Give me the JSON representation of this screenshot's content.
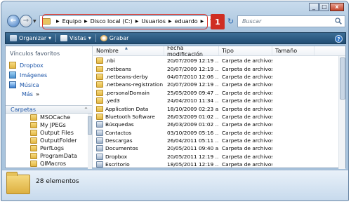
{
  "window": {
    "caption_buttons": {
      "minimize": "_",
      "maximize": "□",
      "close": "x"
    }
  },
  "address_bar": {
    "crumbs": [
      "Equipo",
      "Disco local (C:)",
      "Usuarios",
      "eduardo"
    ],
    "step_badge": "1"
  },
  "search": {
    "placeholder": "Buscar"
  },
  "toolbar": {
    "organize_label": "Organizar",
    "views_label": "Vistas",
    "burn_label": "Grabar",
    "help_label": "?"
  },
  "nav_pane": {
    "favorites_heading": "Vínculos favoritos",
    "favorites": [
      {
        "label": "Dropbox",
        "icon": "dropbox-icon"
      },
      {
        "label": "Imágenes",
        "icon": "pictures-icon"
      },
      {
        "label": "Música",
        "icon": "music-icon"
      }
    ],
    "more_label": "Más",
    "more_arrow": "»",
    "folders_label": "Carpetas",
    "folders_chevron": "^",
    "tree": [
      "MSOCache",
      "My JPEGs",
      "Output Files",
      "OutputFolder",
      "PerfLogs",
      "ProgramData",
      "QIMacros"
    ]
  },
  "file_list": {
    "columns": [
      "Nombre",
      "Fecha modificación",
      "Tipo",
      "Tamaño"
    ],
    "rows": [
      {
        "name": ".nbi",
        "date": "20/07/2009 12:19 ...",
        "type": "Carpeta de archivos",
        "size": "",
        "icon": "folder"
      },
      {
        "name": ".netbeans",
        "date": "20/07/2009 12:19 ...",
        "type": "Carpeta de archivos",
        "size": "",
        "icon": "folder"
      },
      {
        "name": ".netbeans-derby",
        "date": "04/07/2010 12:06 ...",
        "type": "Carpeta de archivos",
        "size": "",
        "icon": "folder"
      },
      {
        "name": ".netbeans-registration",
        "date": "20/07/2009 12:19 ...",
        "type": "Carpeta de archivos",
        "size": "",
        "icon": "folder"
      },
      {
        "name": ".personalDomain",
        "date": "25/05/2009 09:47 ...",
        "type": "Carpeta de archivos",
        "size": "",
        "icon": "folder"
      },
      {
        "name": ".yed3",
        "date": "24/04/2010 11:34 ...",
        "type": "Carpeta de archivos",
        "size": "",
        "icon": "folder"
      },
      {
        "name": "Application Data",
        "date": "18/10/2009 02:23 a...",
        "type": "Carpeta de archivos",
        "size": "",
        "icon": "folder"
      },
      {
        "name": "Bluetooth Software",
        "date": "26/03/2009 01:02 ...",
        "type": "Carpeta de archivos",
        "size": "",
        "icon": "folder"
      },
      {
        "name": "Búsquedas",
        "date": "26/03/2009 01:02 ...",
        "type": "Carpeta de archivos",
        "size": "",
        "icon": "special"
      },
      {
        "name": "Contactos",
        "date": "03/10/2009 05:16 ...",
        "type": "Carpeta de archivos",
        "size": "",
        "icon": "special"
      },
      {
        "name": "Descargas",
        "date": "26/04/2011 05:11 ...",
        "type": "Carpeta de archivos",
        "size": "",
        "icon": "special"
      },
      {
        "name": "Documentos",
        "date": "20/05/2011 09:40 a...",
        "type": "Carpeta de archivos",
        "size": "",
        "icon": "special"
      },
      {
        "name": "Dropbox",
        "date": "20/05/2011 12:19 ...",
        "type": "Carpeta de archivos",
        "size": "",
        "icon": "special"
      },
      {
        "name": "Escritorio",
        "date": "18/05/2011 12:19 ...",
        "type": "Carpeta de archivos",
        "size": "",
        "icon": "special"
      }
    ]
  },
  "status": {
    "count_label": "28 elementos"
  },
  "colors": {
    "accent": "#1c55a8",
    "highlight": "#d9322a",
    "badge": "#cf2e23"
  }
}
